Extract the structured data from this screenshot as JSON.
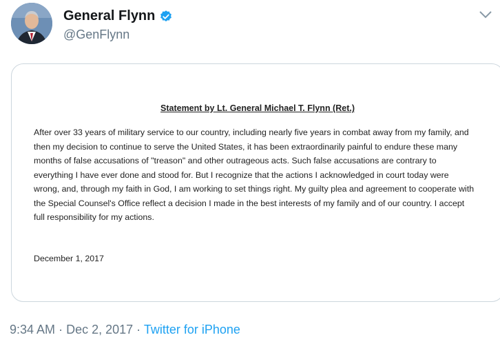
{
  "tweet": {
    "display_name": "General Flynn",
    "handle": "@GenFlynn",
    "verified": true
  },
  "document": {
    "title": "Statement by Lt. General Michael T. Flynn (Ret.)",
    "body": "After over 33 years of military service to our country, including nearly five years in combat away from my family, and then my decision to continue to serve the United States, it has been extraordinarily painful to endure these many months of false accusations of \"treason\" and other outrageous acts.  Such false accusations are contrary to everything I have ever done and stood for.  But I recognize that the actions I acknowledged in court today were wrong, and, through my faith in God, I am working to set things right.  My guilty plea and agreement to cooperate with the Special Counsel's Office reflect a decision I made in the best interests of my family and of our country.  I accept full responsibility for my actions.",
    "date": "December 1, 2017"
  },
  "meta": {
    "time": "9:34 AM",
    "separator": "·",
    "date": "Dec 2, 2017",
    "source": "Twitter for iPhone"
  },
  "colors": {
    "link_blue": "#1da1f2",
    "secondary_text": "#657786"
  }
}
